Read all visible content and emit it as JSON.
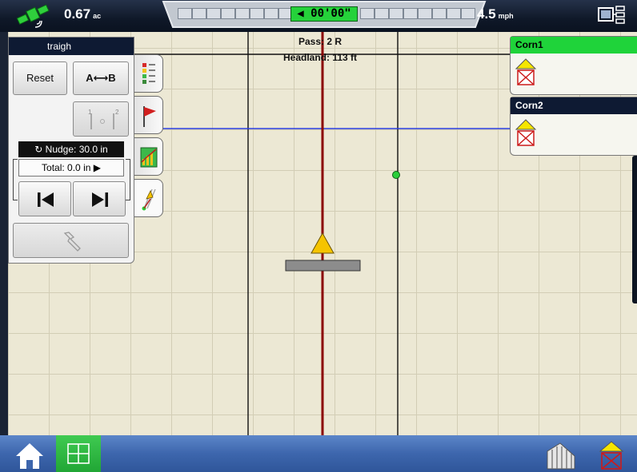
{
  "topbar": {
    "area_value": "0.67",
    "area_unit": "ac",
    "lightbar_value": "◀ 00'00\"",
    "speed_value": "4.5",
    "speed_unit": "mph",
    "icons": [
      "gps-status-icon",
      "display-settings-icon"
    ]
  },
  "map": {
    "pass_label": "Pass: 2 R",
    "headland_label": "Headland: 113 ft"
  },
  "guidance_panel": {
    "title": "traigh",
    "reset_label": "Reset",
    "ab_label": "A⟷B",
    "nudge_label": "Nudge: 30.0 in",
    "total_label": "Total: 0.0 in ▶"
  },
  "side_tabs": [
    "legend-tab",
    "flag-tab",
    "chart-tab",
    "guidance-tab"
  ],
  "products": [
    {
      "name": "Corn1",
      "color": "#1fd33a"
    },
    {
      "name": "Corn2",
      "color": "#0e1a33"
    }
  ],
  "colors": {
    "map_background": "#ece8d4",
    "guidance_line": "#8b0000",
    "ab_line": "#2a3de0",
    "active_green": "#1fd33a",
    "bottom_bar": "#3d66ad"
  }
}
